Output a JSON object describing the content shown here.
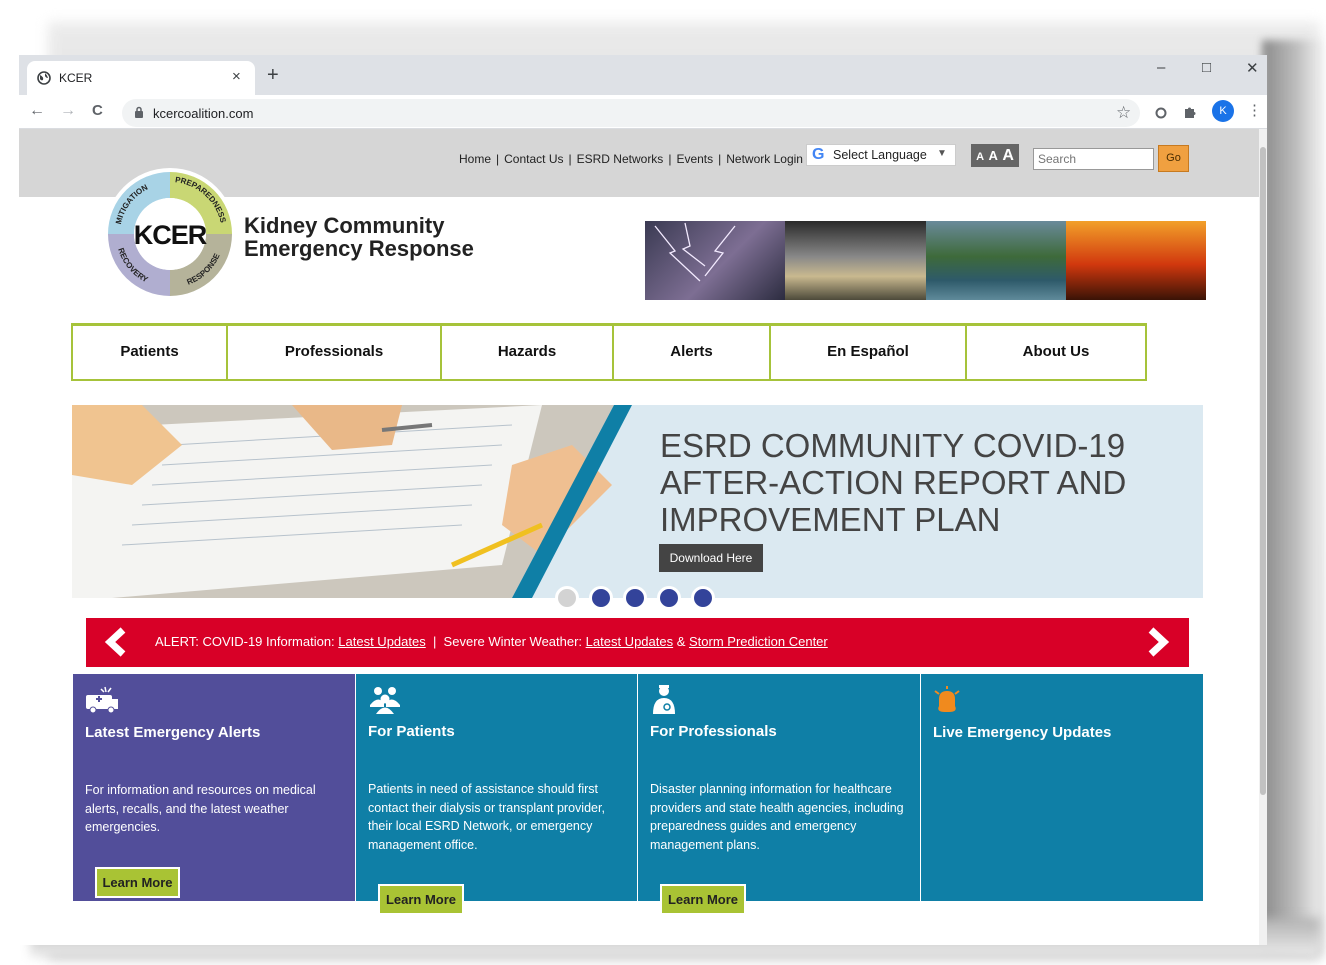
{
  "browser": {
    "tab_title": "KCER",
    "tab_close": "×",
    "new_tab": "+",
    "window_controls": {
      "minimize": "–",
      "maximize": "□",
      "close": "✕"
    },
    "nav": {
      "back": "←",
      "forward": "→",
      "reload": "C"
    },
    "url": "kcercoalition.com",
    "profile_initial": "K",
    "bookmark_star": "☆",
    "menu": "⋮"
  },
  "utility": {
    "links": [
      "Home",
      "Contact Us",
      "ESRD Networks",
      "Events",
      "Network Login"
    ],
    "translate_g": "G",
    "translate_label": "Select Language",
    "translate_arrow": "▼",
    "text_size": [
      "A",
      "A",
      "A"
    ],
    "search_placeholder": "Search",
    "go_label": "Go"
  },
  "logo": {
    "center": "KCER",
    "ring": [
      "MITIGATION",
      "PREPAREDNESS",
      "RESPONSE",
      "RECOVERY"
    ],
    "colors": {
      "mitigation": "#a8d3e6",
      "preparedness": "#c9d774",
      "response": "#b5b39a",
      "recovery": "#b0aed0"
    }
  },
  "site_title": {
    "line1": "Kidney Community",
    "line2": "Emergency Response"
  },
  "main_nav": [
    "Patients",
    "Professionals",
    "Hazards",
    "Alerts",
    "En Español",
    "About Us"
  ],
  "hero": {
    "title": "ESRD COMMUNITY COVID-19 AFTER-ACTION REPORT AND IMPROVEMENT PLAN",
    "button": "Download Here",
    "slides": 5,
    "active_slide": 1
  },
  "alert_bar": {
    "prefix": "ALERT: COVID-19 Information: ",
    "link1": "Latest Updates",
    "middle": "  |  Severe Winter Weather: ",
    "link2": "Latest Updates",
    "amp": " & ",
    "link3": "Storm Prediction Center"
  },
  "cards": [
    {
      "icon": "ambulance-icon",
      "title": "Latest Emergency Alerts",
      "body": "For information and resources on medical alerts, recalls, and the latest weather emergencies.",
      "button": "Learn More",
      "color": "#524e9a"
    },
    {
      "icon": "people-group-icon",
      "title": "For Patients",
      "body": "Patients in need of assistance should first contact their dialysis or transplant provider, their local ESRD Network, or emergency management office.",
      "button": "Learn More",
      "color": "#0f7fa6"
    },
    {
      "icon": "doctor-icon",
      "title": "For Professionals",
      "body": "Disaster planning information for healthcare providers and state health agencies, including preparedness guides and emergency management plans.",
      "button": "Learn More",
      "color": "#0f7fa6"
    },
    {
      "icon": "alarm-bell-icon",
      "title": "Live Emergency Updates",
      "body": "",
      "button": "",
      "color": "#0f7fa6"
    }
  ]
}
